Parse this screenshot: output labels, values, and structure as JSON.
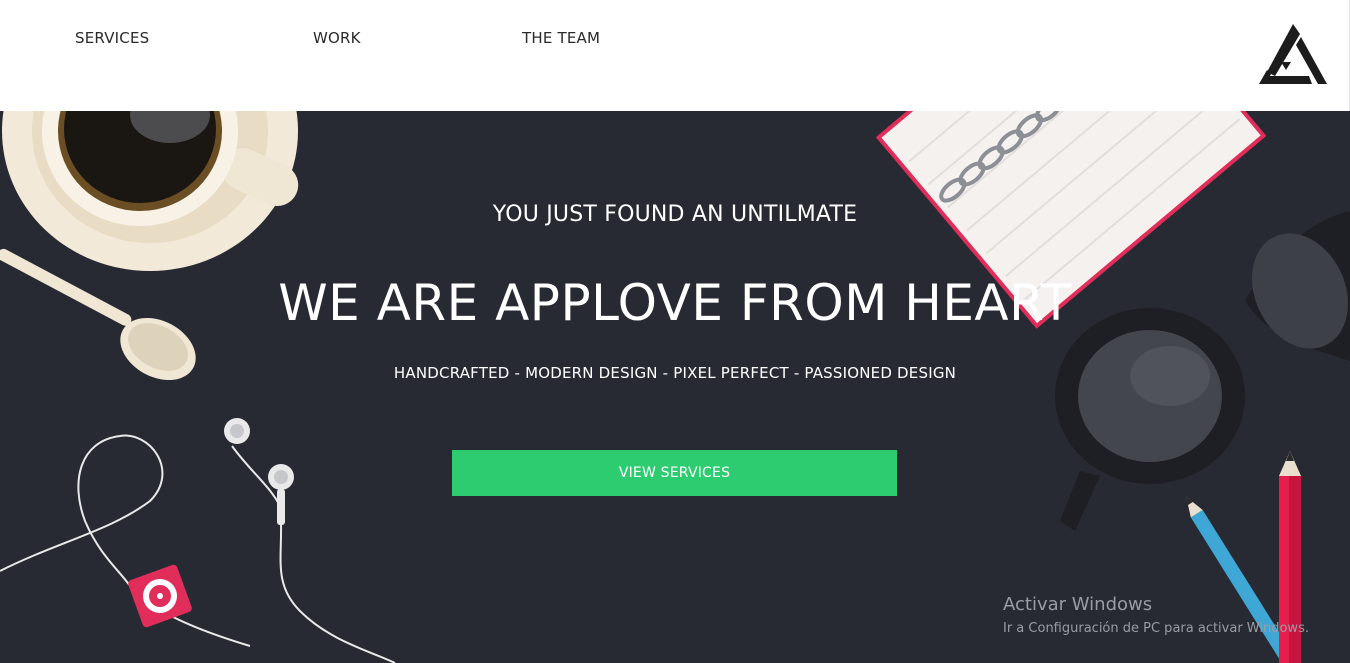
{
  "nav": {
    "items": [
      {
        "label": "SERVICES"
      },
      {
        "label": "WORK"
      },
      {
        "label": "THE TEAM"
      }
    ],
    "logo_icon": "triangle-recycle-icon"
  },
  "hero": {
    "kicker": "YOU JUST FOUND AN UNTILMATE",
    "title": "WE ARE APPLOVE FROM HEART",
    "tagline": "HANDCRAFTED - MODERN DESIGN - PIXEL PERFECT - PASSIONED DESIGN",
    "cta_label": "VIEW SERVICES",
    "background_color": "#272a33",
    "cta_color": "#2ecc71"
  },
  "decor": {
    "icons": [
      "coffee-cup-icon",
      "spoon-icon",
      "earphones-icon",
      "music-player-icon",
      "notebook-icon",
      "glasses-icon",
      "blue-pencil-icon",
      "red-pencil-icon"
    ]
  },
  "watermark": {
    "title": "Activar Windows",
    "subtitle": "Ir a Configuración de PC para activar Windows."
  }
}
